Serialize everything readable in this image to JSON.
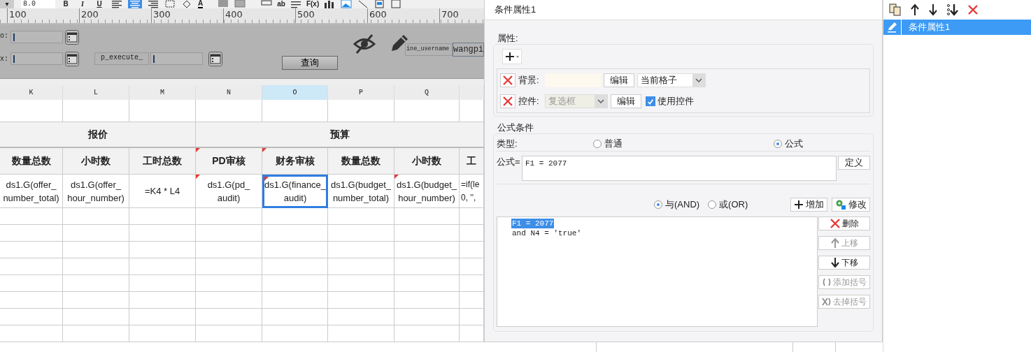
{
  "toolbar": {
    "dropdown_caret": "▾",
    "font_size": "8.0",
    "format_buttons": [
      "B",
      "I",
      "U"
    ],
    "align": [
      {
        "selected": false
      },
      {
        "selected": true
      },
      {
        "selected": false
      }
    ],
    "font_color": "A",
    "text_items": [
      "ab",
      "F(x)"
    ]
  },
  "ruler": [
    "100",
    "200",
    "300",
    "400",
    "500",
    "600",
    "700"
  ],
  "parameter_panel": {
    "fields": [
      {
        "label": "o:"
      },
      {
        "label": "x:"
      },
      {
        "label": "p_execute_"
      }
    ],
    "query_button": "查询",
    "username_label": "ine_username",
    "username_value": "wangpi"
  },
  "sheet": {
    "columns": [
      {
        "label": "K",
        "selected": false
      },
      {
        "label": "L",
        "selected": false
      },
      {
        "label": "M",
        "selected": false
      },
      {
        "label": "N",
        "selected": false
      },
      {
        "label": "O",
        "selected": true
      },
      {
        "label": "P",
        "selected": false
      },
      {
        "label": "Q",
        "selected": false
      }
    ],
    "groups": [
      {
        "label": "报价"
      },
      {
        "label": "预算"
      }
    ],
    "headers": [
      {
        "text": "数量总数",
        "flagged": false
      },
      {
        "text": "小时数",
        "flagged": false
      },
      {
        "text": "工时总数",
        "flagged": false
      },
      {
        "text": "PD审核",
        "flagged": true
      },
      {
        "text": "财务审核",
        "flagged": true
      },
      {
        "text": "数量总数",
        "flagged": false
      },
      {
        "text": "小时数",
        "flagged": false
      },
      {
        "text": "工",
        "flagged": false
      }
    ],
    "cells": [
      {
        "lines": [
          "ds1.G(offer_",
          "number_total)"
        ],
        "selected": false,
        "flagged": false
      },
      {
        "lines": [
          "ds1.G(offer_",
          "hour_number)"
        ],
        "selected": false,
        "flagged": false
      },
      {
        "lines": [
          "=K4 * L4"
        ],
        "selected": false,
        "flagged": false
      },
      {
        "lines": [
          "ds1.G(pd_",
          "audit)"
        ],
        "selected": false,
        "flagged": true
      },
      {
        "lines": [
          "ds1.G(finance_",
          "audit)"
        ],
        "selected": true,
        "flagged": true
      },
      {
        "lines": [
          "ds1.G(budget_",
          "number_total)"
        ],
        "selected": false,
        "flagged": false
      },
      {
        "lines": [
          "ds1.G(budget_",
          "hour_number)"
        ],
        "selected": false,
        "flagged": true
      },
      {
        "lines": [
          "=if(le",
          "0, '',"
        ],
        "selected": false,
        "flagged": false
      }
    ]
  },
  "dialog": {
    "title": "条件属性1",
    "attributes": {
      "legend": "属性:",
      "rows": [
        {
          "kind": "background",
          "label": "背景:",
          "edit": "编辑",
          "select": "当前格子",
          "select_disabled": false
        },
        {
          "kind": "widget",
          "label": "控件:",
          "edit": "编辑",
          "select": "复选框",
          "select_disabled": true,
          "checkbox": {
            "label": "使用控件",
            "checked": true
          }
        }
      ]
    },
    "formula_condition": {
      "legend": "公式条件",
      "type_label": "类型:",
      "types": [
        {
          "label": "普通",
          "selected": false
        },
        {
          "label": "公式",
          "selected": true
        }
      ],
      "formula_label": "公式=",
      "formula_value": "F1 = 2077",
      "define_button": "定义",
      "logic": [
        {
          "label": "与(AND)",
          "selected": true
        },
        {
          "label": "或(OR)",
          "selected": false
        }
      ],
      "add_button": "增加",
      "modify_button": "修改",
      "conditions": [
        {
          "text": "F1 = 2077",
          "selected": true
        },
        {
          "text": "and N4 = 'true'",
          "selected": false
        }
      ],
      "side_buttons": [
        {
          "kind": "delete",
          "label": "删除",
          "disabled": false
        },
        {
          "kind": "up",
          "label": "上移",
          "disabled": true
        },
        {
          "kind": "down",
          "label": "下移",
          "disabled": false
        },
        {
          "kind": "group",
          "label": "添加括号",
          "disabled": true
        },
        {
          "kind": "ungroup",
          "label": "去掉括号",
          "disabled": true
        }
      ]
    }
  },
  "condition_list": [
    {
      "label": "条件属性1",
      "selected": true
    }
  ]
}
